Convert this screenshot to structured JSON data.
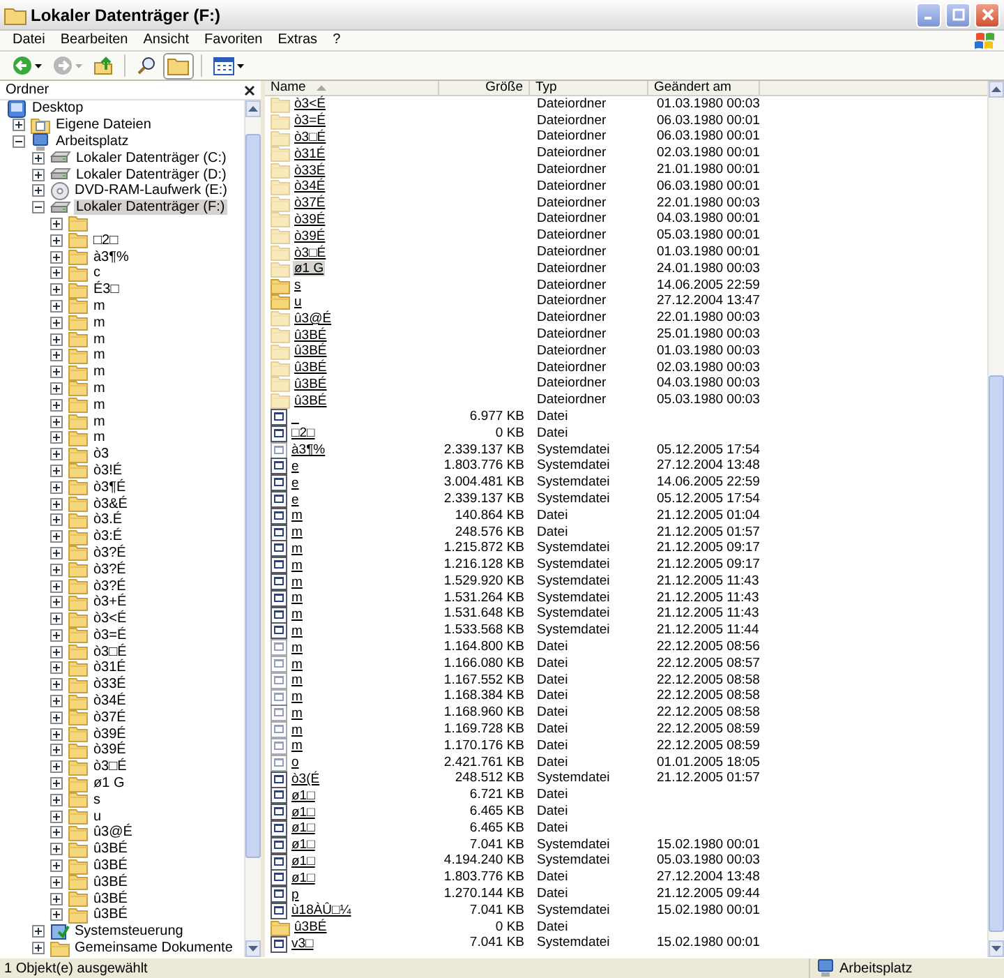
{
  "window": {
    "title": "Lokaler Datenträger (F:)"
  },
  "menu": [
    "Datei",
    "Bearbeiten",
    "Ansicht",
    "Favoriten",
    "Extras",
    "?"
  ],
  "toolbar": {
    "folders_selected": true
  },
  "folder_pane": {
    "title": "Ordner"
  },
  "tree": {
    "label": "Desktop",
    "kind": "desktop",
    "selected": false,
    "children": [
      {
        "label": "Eigene Dateien",
        "kind": "documents",
        "expanded": false,
        "selected": false
      },
      {
        "label": "Arbeitsplatz",
        "kind": "computer",
        "expanded": true,
        "selected": false,
        "children": [
          {
            "label": "Lokaler Datenträger (C:)",
            "kind": "drive",
            "expanded": false,
            "selected": false
          },
          {
            "label": "Lokaler Datenträger (D:)",
            "kind": "drive",
            "expanded": false,
            "selected": false
          },
          {
            "label": "DVD-RAM-Laufwerk (E:)",
            "kind": "dvd",
            "expanded": false,
            "selected": false
          },
          {
            "label": "Lokaler Datenträger (F:)",
            "kind": "drive",
            "expanded": true,
            "selected": true,
            "children": [
              {
                "kind": "folder",
                "expanded": false,
                "selected": false
              },
              {
                "label": "□2□",
                "kind": "folder",
                "expanded": false,
                "selected": false
              },
              {
                "label": "à3¶%",
                "kind": "folder",
                "expanded": false,
                "selected": false
              },
              {
                "label": "c",
                "kind": "folder",
                "expanded": false,
                "selected": false
              },
              {
                "label": "É3□",
                "kind": "folder",
                "expanded": false,
                "selected": false
              },
              {
                "label": "m",
                "kind": "folder",
                "expanded": false,
                "selected": false
              },
              {
                "label": "m",
                "kind": "folder",
                "expanded": false,
                "selected": false
              },
              {
                "label": "m",
                "kind": "folder",
                "expanded": false,
                "selected": false
              },
              {
                "label": "m",
                "kind": "folder",
                "expanded": false,
                "selected": false
              },
              {
                "label": "m",
                "kind": "folder",
                "expanded": false,
                "selected": false
              },
              {
                "label": "m",
                "kind": "folder",
                "expanded": false,
                "selected": false
              },
              {
                "label": "m",
                "kind": "folder",
                "expanded": false,
                "selected": false
              },
              {
                "label": "m",
                "kind": "folder",
                "expanded": false,
                "selected": false
              },
              {
                "label": "m",
                "kind": "folder",
                "expanded": false,
                "selected": false
              },
              {
                "label": "ò3",
                "kind": "folder",
                "expanded": false,
                "selected": false
              },
              {
                "label": "ò3!É",
                "kind": "folder",
                "expanded": false,
                "selected": false
              },
              {
                "label": "ò3¶É",
                "kind": "folder",
                "expanded": false,
                "selected": false
              },
              {
                "label": "ò3&É",
                "kind": "folder",
                "expanded": false,
                "selected": false
              },
              {
                "label": "ò3.É",
                "kind": "folder",
                "expanded": false,
                "selected": false
              },
              {
                "label": "ò3:É",
                "kind": "folder",
                "expanded": false,
                "selected": false
              },
              {
                "label": "ò3?É",
                "kind": "folder",
                "expanded": false,
                "selected": false
              },
              {
                "label": "ò3?É",
                "kind": "folder",
                "expanded": false,
                "selected": false
              },
              {
                "label": "ò3?É",
                "kind": "folder",
                "expanded": false,
                "selected": false
              },
              {
                "label": "ò3+É",
                "kind": "folder",
                "expanded": false,
                "selected": false
              },
              {
                "label": "ò3<É",
                "kind": "folder",
                "expanded": false,
                "selected": false
              },
              {
                "label": "ò3=É",
                "kind": "folder",
                "expanded": false,
                "selected": false
              },
              {
                "label": "ò3□É",
                "kind": "folder",
                "expanded": false,
                "selected": false
              },
              {
                "label": "ò31É",
                "kind": "folder",
                "expanded": false,
                "selected": false
              },
              {
                "label": "ò33É",
                "kind": "folder",
                "expanded": false,
                "selected": false
              },
              {
                "label": "ò34É",
                "kind": "folder",
                "expanded": false,
                "selected": false
              },
              {
                "label": "ò37É",
                "kind": "folder",
                "expanded": false,
                "selected": false
              },
              {
                "label": "ò39É",
                "kind": "folder",
                "expanded": false,
                "selected": false
              },
              {
                "label": "ò39É",
                "kind": "folder",
                "expanded": false,
                "selected": false
              },
              {
                "label": "ò3□É",
                "kind": "folder",
                "expanded": false,
                "selected": false
              },
              {
                "label": "ø1 G",
                "kind": "folder",
                "expanded": false,
                "selected": false
              },
              {
                "label": "s",
                "kind": "folder",
                "expanded": false,
                "selected": false
              },
              {
                "label": "u",
                "kind": "folder",
                "expanded": false,
                "selected": false
              },
              {
                "label": "û3@É",
                "kind": "folder",
                "expanded": false,
                "selected": false
              },
              {
                "label": "û3BÉ",
                "kind": "folder",
                "expanded": false,
                "selected": false
              },
              {
                "label": "û3BÉ",
                "kind": "folder",
                "expanded": false,
                "selected": false
              },
              {
                "label": "û3BÉ",
                "kind": "folder",
                "expanded": false,
                "selected": false
              },
              {
                "label": "û3BÉ",
                "kind": "folder",
                "expanded": false,
                "selected": false
              },
              {
                "label": "û3BÉ",
                "kind": "folder",
                "expanded": false,
                "selected": false
              }
            ]
          },
          {
            "label": "Systemsteuerung",
            "kind": "control-panel",
            "expanded": false,
            "selected": false
          },
          {
            "label": "Gemeinsame Dokumente",
            "kind": "folder",
            "expanded": false,
            "selected": false
          }
        ]
      }
    ]
  },
  "columns": [
    {
      "label": "Name",
      "sorted": true
    },
    {
      "label": "Größe",
      "sorted": false
    },
    {
      "label": "Typ",
      "sorted": false
    },
    {
      "label": "Geändert am",
      "sorted": false
    }
  ],
  "rows": [
    {
      "kind": "folder",
      "hidden": true,
      "selected": false,
      "name": "ò3<É",
      "type": "Dateiordner",
      "modified": "01.03.1980 00:03"
    },
    {
      "kind": "folder",
      "hidden": true,
      "selected": false,
      "name": "ò3=É",
      "type": "Dateiordner",
      "modified": "06.03.1980 00:01"
    },
    {
      "kind": "folder",
      "hidden": true,
      "selected": false,
      "name": "ò3□É",
      "type": "Dateiordner",
      "modified": "06.03.1980 00:01"
    },
    {
      "kind": "folder",
      "hidden": true,
      "selected": false,
      "name": "ò31É",
      "type": "Dateiordner",
      "modified": "02.03.1980 00:01"
    },
    {
      "kind": "folder",
      "hidden": true,
      "selected": false,
      "name": "ò33É",
      "type": "Dateiordner",
      "modified": "21.01.1980 00:01"
    },
    {
      "kind": "folder",
      "hidden": true,
      "selected": false,
      "name": "ò34É",
      "type": "Dateiordner",
      "modified": "06.03.1980 00:01"
    },
    {
      "kind": "folder",
      "hidden": true,
      "selected": false,
      "name": "ò37É",
      "type": "Dateiordner",
      "modified": "22.01.1980 00:03"
    },
    {
      "kind": "folder",
      "hidden": true,
      "selected": false,
      "name": "ò39É",
      "type": "Dateiordner",
      "modified": "04.03.1980 00:01"
    },
    {
      "kind": "folder",
      "hidden": true,
      "selected": false,
      "name": "ò39É",
      "type": "Dateiordner",
      "modified": "05.03.1980 00:01"
    },
    {
      "kind": "folder",
      "hidden": true,
      "selected": false,
      "name": "ò3□É",
      "type": "Dateiordner",
      "modified": "01.03.1980 00:01"
    },
    {
      "kind": "folder",
      "hidden": true,
      "selected": true,
      "name": "ø1 G",
      "type": "Dateiordner",
      "modified": "24.01.1980 00:03"
    },
    {
      "kind": "folder",
      "hidden": false,
      "selected": false,
      "name": "s",
      "type": "Dateiordner",
      "modified": "14.06.2005 22:59"
    },
    {
      "kind": "folder",
      "hidden": false,
      "selected": false,
      "name": "u",
      "type": "Dateiordner",
      "modified": "27.12.2004 13:47"
    },
    {
      "kind": "folder",
      "hidden": true,
      "selected": false,
      "name": "û3@É",
      "type": "Dateiordner",
      "modified": "22.01.1980 00:03"
    },
    {
      "kind": "folder",
      "hidden": true,
      "selected": false,
      "name": "û3BÉ",
      "type": "Dateiordner",
      "modified": "25.01.1980 00:03"
    },
    {
      "kind": "folder",
      "hidden": true,
      "selected": false,
      "name": "û3BÉ",
      "type": "Dateiordner",
      "modified": "01.03.1980 00:03"
    },
    {
      "kind": "folder",
      "hidden": true,
      "selected": false,
      "name": "û3BÉ",
      "type": "Dateiordner",
      "modified": "02.03.1980 00:03"
    },
    {
      "kind": "folder",
      "hidden": true,
      "selected": false,
      "name": "û3BÉ",
      "type": "Dateiordner",
      "modified": "04.03.1980 00:03"
    },
    {
      "kind": "folder",
      "hidden": true,
      "selected": false,
      "name": "û3BÉ",
      "type": "Dateiordner",
      "modified": "05.03.1980 00:03"
    },
    {
      "kind": "file",
      "hidden": false,
      "selected": false,
      "name": "_",
      "size": "6.977 KB",
      "type": "Datei"
    },
    {
      "kind": "file",
      "hidden": false,
      "selected": false,
      "name": "□2□",
      "size": "0 KB",
      "type": "Datei"
    },
    {
      "kind": "file",
      "hidden": true,
      "selected": false,
      "name": "à3¶%",
      "size": "2.339.137 KB",
      "type": "Systemdatei",
      "modified": "05.12.2005 17:54"
    },
    {
      "kind": "file",
      "hidden": false,
      "selected": false,
      "name": "e",
      "size": "1.803.776 KB",
      "type": "Systemdatei",
      "modified": "27.12.2004 13:48"
    },
    {
      "kind": "file",
      "hidden": false,
      "selected": false,
      "name": "e",
      "size": "3.004.481 KB",
      "type": "Systemdatei",
      "modified": "14.06.2005 22:59"
    },
    {
      "kind": "file",
      "hidden": false,
      "selected": false,
      "name": "e",
      "size": "2.339.137 KB",
      "type": "Systemdatei",
      "modified": "05.12.2005 17:54"
    },
    {
      "kind": "file",
      "hidden": false,
      "selected": false,
      "name": "m",
      "size": "140.864 KB",
      "type": "Datei",
      "modified": "21.12.2005 01:04"
    },
    {
      "kind": "file",
      "hidden": false,
      "selected": false,
      "name": "m",
      "size": "248.576 KB",
      "type": "Datei",
      "modified": "21.12.2005 01:57"
    },
    {
      "kind": "file",
      "hidden": false,
      "selected": false,
      "name": "m",
      "size": "1.215.872 KB",
      "type": "Systemdatei",
      "modified": "21.12.2005 09:17"
    },
    {
      "kind": "file",
      "hidden": false,
      "selected": false,
      "name": "m",
      "size": "1.216.128 KB",
      "type": "Systemdatei",
      "modified": "21.12.2005 09:17"
    },
    {
      "kind": "file",
      "hidden": false,
      "selected": false,
      "name": "m",
      "size": "1.529.920 KB",
      "type": "Systemdatei",
      "modified": "21.12.2005 11:43"
    },
    {
      "kind": "file",
      "hidden": false,
      "selected": false,
      "name": "m",
      "size": "1.531.264 KB",
      "type": "Systemdatei",
      "modified": "21.12.2005 11:43"
    },
    {
      "kind": "file",
      "hidden": false,
      "selected": false,
      "name": "m",
      "size": "1.531.648 KB",
      "type": "Systemdatei",
      "modified": "21.12.2005 11:43"
    },
    {
      "kind": "file",
      "hidden": false,
      "selected": false,
      "name": "m",
      "size": "1.533.568 KB",
      "type": "Systemdatei",
      "modified": "21.12.2005 11:44"
    },
    {
      "kind": "file",
      "hidden": true,
      "selected": false,
      "name": "m",
      "size": "1.164.800 KB",
      "type": "Datei",
      "modified": "22.12.2005 08:56"
    },
    {
      "kind": "file",
      "hidden": true,
      "selected": false,
      "name": "m",
      "size": "1.166.080 KB",
      "type": "Datei",
      "modified": "22.12.2005 08:57"
    },
    {
      "kind": "file",
      "hidden": true,
      "selected": false,
      "name": "m",
      "size": "1.167.552 KB",
      "type": "Datei",
      "modified": "22.12.2005 08:58"
    },
    {
      "kind": "file",
      "hidden": true,
      "selected": false,
      "name": "m",
      "size": "1.168.384 KB",
      "type": "Datei",
      "modified": "22.12.2005 08:58"
    },
    {
      "kind": "file",
      "hidden": true,
      "selected": false,
      "name": "m",
      "size": "1.168.960 KB",
      "type": "Datei",
      "modified": "22.12.2005 08:58"
    },
    {
      "kind": "file",
      "hidden": true,
      "selected": false,
      "name": "m",
      "size": "1.169.728 KB",
      "type": "Datei",
      "modified": "22.12.2005 08:59"
    },
    {
      "kind": "file",
      "hidden": true,
      "selected": false,
      "name": "m",
      "size": "1.170.176 KB",
      "type": "Datei",
      "modified": "22.12.2005 08:59"
    },
    {
      "kind": "file",
      "hidden": true,
      "selected": false,
      "name": "o",
      "size": "2.421.761 KB",
      "type": "Datei",
      "modified": "01.01.2005 18:05"
    },
    {
      "kind": "file",
      "hidden": false,
      "selected": false,
      "name": "ò3(É",
      "size": "248.512 KB",
      "type": "Systemdatei",
      "modified": "21.12.2005 01:57"
    },
    {
      "kind": "file",
      "hidden": false,
      "selected": false,
      "name": "ø1□",
      "size": "6.721 KB",
      "type": "Datei"
    },
    {
      "kind": "file",
      "hidden": false,
      "selected": false,
      "name": "ø1□",
      "size": "6.465 KB",
      "type": "Datei"
    },
    {
      "kind": "file",
      "hidden": false,
      "selected": false,
      "name": "ø1□",
      "size": "6.465 KB",
      "type": "Datei"
    },
    {
      "kind": "file",
      "hidden": false,
      "selected": false,
      "name": "ø1□",
      "size": "7.041 KB",
      "type": "Systemdatei",
      "modified": "15.02.1980 00:01"
    },
    {
      "kind": "file",
      "hidden": false,
      "selected": false,
      "name": "ø1□",
      "size": "4.194.240 KB",
      "type": "Systemdatei",
      "modified": "05.03.1980 00:03"
    },
    {
      "kind": "file",
      "hidden": false,
      "selected": false,
      "name": "ø1□",
      "size": "1.803.776 KB",
      "type": "Datei",
      "modified": "27.12.2004 13:48"
    },
    {
      "kind": "file",
      "hidden": false,
      "selected": false,
      "name": "p",
      "size": "1.270.144 KB",
      "type": "Datei",
      "modified": "21.12.2005 09:44"
    },
    {
      "kind": "file",
      "hidden": false,
      "selected": false,
      "name": "ù18ÀÛ□¼",
      "size": "7.041 KB",
      "type": "Systemdatei",
      "modified": "15.02.1980 00:01"
    },
    {
      "kind": "folder",
      "hidden": false,
      "selected": false,
      "name": "û3BÉ",
      "size": "0 KB",
      "type": "Datei"
    },
    {
      "kind": "file",
      "hidden": false,
      "selected": false,
      "name": "v3□",
      "size": "7.041 KB",
      "type": "Systemdatei",
      "modified": "15.02.1980 00:01"
    }
  ],
  "status_bar": {
    "text": "1 Objekt(e) ausgewählt",
    "zone": "Arbeitsplatz"
  }
}
